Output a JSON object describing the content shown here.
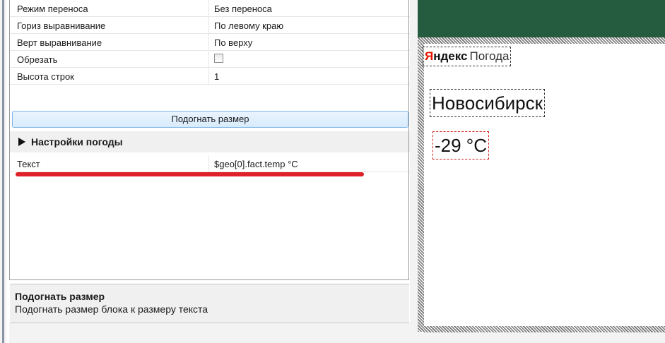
{
  "properties": [
    {
      "name": "Режим переноса",
      "value": "Без переноса"
    },
    {
      "name": "Гориз выравнивание",
      "value": "По левому краю"
    },
    {
      "name": "Верт выравнивание",
      "value": "По верху"
    },
    {
      "name": "Обрезать",
      "checked": false
    },
    {
      "name": "Высота строк",
      "value": "1"
    }
  ],
  "fit_button": {
    "label": "Подогнать размер"
  },
  "weather_group": {
    "label": "Настройки погоды",
    "text_property": {
      "name": "Текст",
      "value": "$geo[0].fact.temp °C"
    }
  },
  "status": {
    "title": "Подогнать размер",
    "description": "Подогнать размер блока к размеру текста"
  },
  "preview": {
    "logo_ya": "Я",
    "logo_ndex": "ндекс",
    "logo_pogoda": "Погода",
    "city": "Новосибирск",
    "temperature": "-29 °C"
  },
  "colors": {
    "header_green": "#255b3f",
    "highlight_red": "#e0202a",
    "button_blue": "#d8ebfc"
  }
}
